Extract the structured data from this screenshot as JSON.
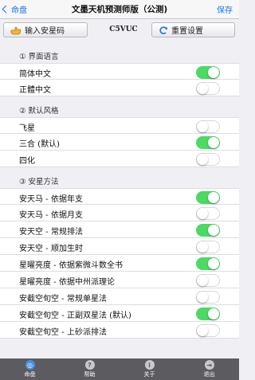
{
  "nav": {
    "back_label": "命盘",
    "title": "文墨天机预测师版（公测)",
    "save_label": "保存"
  },
  "toolbar": {
    "input_label": "输入安星码",
    "code": "C5VUC",
    "reset_label": "重置设置"
  },
  "sections": [
    {
      "header": "① 界面语言",
      "items": [
        {
          "label": "简体中文",
          "on": true
        },
        {
          "label": "正體中文",
          "on": false
        }
      ]
    },
    {
      "header": "② 默认风格",
      "items": [
        {
          "label": "飞星",
          "on": false
        },
        {
          "label": "三合 (默认)",
          "on": true
        },
        {
          "label": "四化",
          "on": false
        }
      ]
    },
    {
      "header": "③ 安星方法",
      "items": [
        {
          "label": "安天马 - 依据年支",
          "on": true
        },
        {
          "label": "安天马 - 依据月支",
          "on": false
        },
        {
          "label": "安天空 - 常规排法",
          "on": true
        },
        {
          "label": "安天空 - 顺加生时",
          "on": false
        },
        {
          "label": "星曜亮度 - 依据紫微斗数全书",
          "on": true
        },
        {
          "label": "星曜亮度 - 依据中州派理论",
          "on": false
        },
        {
          "label": "安截空旬空 - 常规单星法",
          "on": false
        },
        {
          "label": "安截空旬空 - 正副双星法 (默认)",
          "on": true
        },
        {
          "label": "安截空旬空 - 上砂派排法",
          "on": false
        }
      ]
    }
  ],
  "tabbar": [
    {
      "label": "命盘",
      "icon": "chart-icon",
      "active": true
    },
    {
      "label": "帮助",
      "icon": "help-icon",
      "active": false
    },
    {
      "label": "关于",
      "icon": "info-icon",
      "active": false
    },
    {
      "label": "退出",
      "icon": "exit-icon",
      "active": false
    }
  ],
  "colors": {
    "accent": "#1a73e8",
    "toggle_on": "#4cd964",
    "tabbar_bg": "#5c5c60",
    "page_bg": "#f0eff4"
  }
}
